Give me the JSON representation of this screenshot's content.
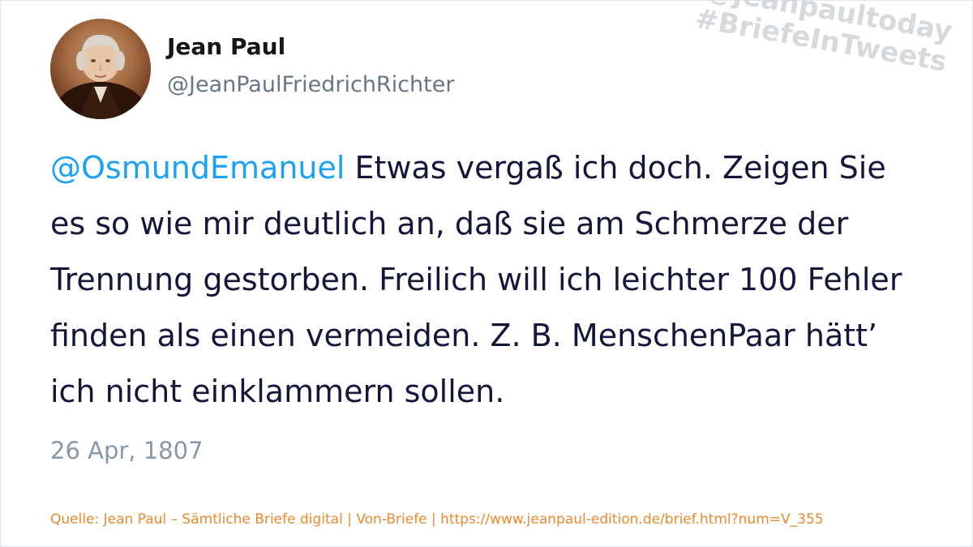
{
  "user": {
    "display_name": "Jean Paul",
    "handle": "@JeanPaulFriedrichRichter"
  },
  "watermark": {
    "line1": "@jeanpaultoday",
    "line2": "#BriefeInTweets"
  },
  "tweet": {
    "mention": "@OsmundEmanuel",
    "body": " Etwas vergaß ich doch. Zeigen Sie es so wie mir deutlich an, daß sie am Schmerze der Trennung gestorben. Freilich will ich leichter 100 Fehler finden als einen vermeiden. Z. B. MenschenPaar hätt’ ich nicht einklammern sollen.",
    "date": "26 Apr, 1807"
  },
  "source": {
    "text": "Quelle: Jean Paul – Sämtliche Briefe digital | Von-Briefe | https://www.jeanpaul-edition.de/brief.html?num=V_355"
  },
  "colors": {
    "mention": "#1da1f2",
    "text": "#14173a",
    "muted": "#8899a6",
    "source": "#e8892e",
    "watermark": "#d2d6d9"
  }
}
